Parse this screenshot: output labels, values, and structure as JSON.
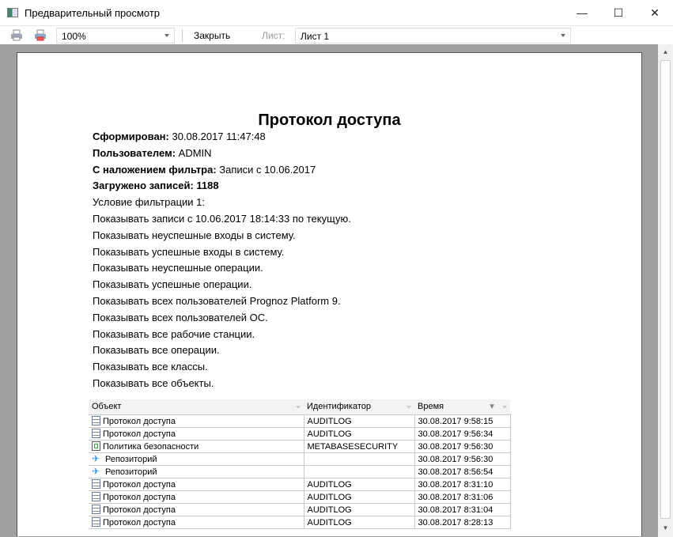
{
  "window": {
    "title": "Предварительный просмотр",
    "minimize": "—",
    "maximize": "☐",
    "close": "✕"
  },
  "toolbar": {
    "zoom": "100%",
    "close_label": "Закрыть",
    "sheet_label": "Лист:",
    "sheet_value": "Лист 1"
  },
  "report": {
    "title": "Протокол доступа",
    "fields": [
      {
        "label": "Сформирован:",
        "value": " 30.08.2017 11:47:48"
      },
      {
        "label": "Пользователем:",
        "value": " ADMIN"
      },
      {
        "label": "С наложением фильтра:",
        "value": " Записи с 10.06.2017"
      },
      {
        "label": "Загружено записей: 1188",
        "value": ""
      }
    ],
    "conditions": [
      "Условие фильтрации 1:",
      "Показывать записи с 10.06.2017 18:14:33 по текущую.",
      "Показывать неуспешные входы в систему.",
      "Показывать успешные входы в систему.",
      "Показывать неуспешные операции.",
      "Показывать успешные операции.",
      "Показывать всех пользователей Prognoz Platform 9.",
      "Показывать всех пользователей ОС.",
      "Показывать все рабочие станции.",
      "Показывать все операции.",
      "Показывать все классы.",
      "Показывать все объекты."
    ]
  },
  "table": {
    "headers": [
      "Объект",
      "Идентификатор",
      "Время"
    ],
    "rows": [
      {
        "icon": "document-icon",
        "object": "Протокол доступа",
        "id": "AUDITLOG",
        "time": "30.08.2017 9:58:15"
      },
      {
        "icon": "document-icon",
        "object": "Протокол доступа",
        "id": "AUDITLOG",
        "time": "30.08.2017 9:56:34"
      },
      {
        "icon": "security-policy-icon",
        "object": "Политика безопасности",
        "id": "METABASESECURITY",
        "time": "30.08.2017 9:56:30"
      },
      {
        "icon": "repository-icon",
        "object": "Репозиторий",
        "id": "",
        "time": "30.08.2017 9:56:30"
      },
      {
        "icon": "repository-icon",
        "object": "Репозиторий",
        "id": "",
        "time": "30.08.2017 8:56:54"
      },
      {
        "icon": "document-icon",
        "object": "Протокол доступа",
        "id": "AUDITLOG",
        "time": "30.08.2017 8:31:10"
      },
      {
        "icon": "document-icon",
        "object": "Протокол доступа",
        "id": "AUDITLOG",
        "time": "30.08.2017 8:31:06"
      },
      {
        "icon": "document-icon",
        "object": "Протокол доступа",
        "id": "AUDITLOG",
        "time": "30.08.2017 8:31:04"
      },
      {
        "icon": "document-icon",
        "object": "Протокол доступа",
        "id": "AUDITLOG",
        "time": "30.08.2017 8:28:13"
      }
    ]
  }
}
